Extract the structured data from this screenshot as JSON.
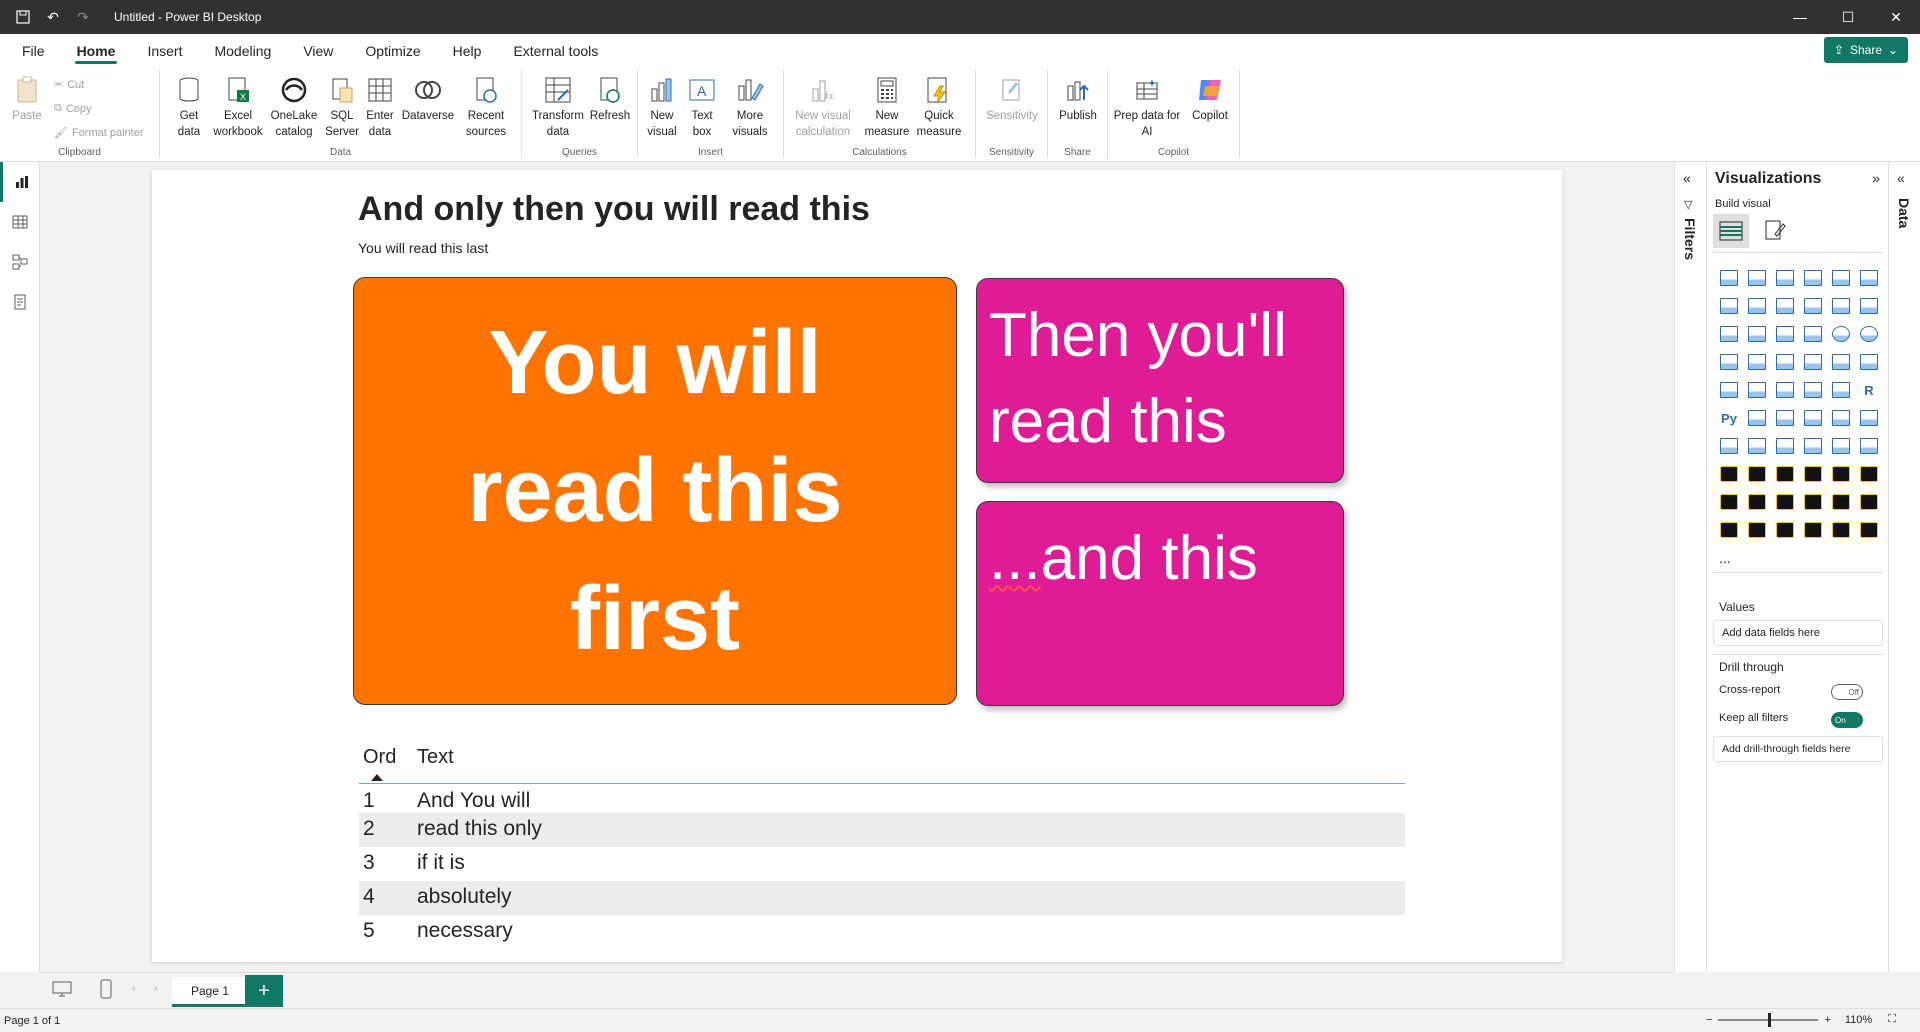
{
  "window": {
    "title": "Untitled - Power BI Desktop"
  },
  "menu": {
    "tabs": [
      "File",
      "Home",
      "Insert",
      "Modeling",
      "View",
      "Optimize",
      "Help",
      "External tools"
    ],
    "share": "Share"
  },
  "ribbon": {
    "clipboard": {
      "paste": "Paste",
      "cut": "Cut",
      "copy": "Copy",
      "format_painter": "Format painter",
      "label": "Clipboard"
    },
    "data": {
      "label": "Data",
      "get_data": [
        "Get",
        "data"
      ],
      "excel": [
        "Excel",
        "workbook"
      ],
      "onelake": [
        "OneLake",
        "catalog"
      ],
      "sql": [
        "SQL",
        "Server"
      ],
      "enter": [
        "Enter",
        "data"
      ],
      "dataverse": [
        "Dataverse",
        ""
      ],
      "recent": [
        "Recent",
        "sources"
      ]
    },
    "queries": {
      "label": "Queries",
      "transform": [
        "Transform",
        "data"
      ],
      "refresh": [
        "Refresh",
        ""
      ]
    },
    "insert": {
      "label": "Insert",
      "new_visual": [
        "New",
        "visual"
      ],
      "text_box": [
        "Text",
        "box"
      ],
      "more_visuals": [
        "More",
        "visuals"
      ]
    },
    "calculations": {
      "label": "Calculations",
      "new_visual_calc": [
        "New visual",
        "calculation"
      ],
      "new_measure": [
        "New",
        "measure"
      ],
      "quick_measure": [
        "Quick",
        "measure"
      ]
    },
    "sensitivity": {
      "label": "Sensitivity",
      "btn": [
        "Sensitivity",
        ""
      ]
    },
    "share": {
      "label": "Share",
      "publish": [
        "Publish",
        ""
      ]
    },
    "copilot": {
      "label": "Copilot",
      "prep": [
        "Prep data for",
        "AI"
      ],
      "copilot": [
        "Copilot",
        ""
      ]
    }
  },
  "report": {
    "title": "And only then you will read this",
    "subtitle": "You will read this last",
    "card_orange": [
      "You will",
      "read this",
      "first"
    ],
    "card_pink1": [
      "Then you'll",
      "read this"
    ],
    "card_pink2_prefix": "...",
    "card_pink2_text": "and this",
    "table": {
      "headers": [
        "Ord",
        "Text"
      ],
      "rows": [
        [
          "1",
          "And You will"
        ],
        [
          "2",
          "read this only"
        ],
        [
          "3",
          "if it is"
        ],
        [
          "4",
          "absolutely"
        ],
        [
          "5",
          "necessary"
        ]
      ]
    }
  },
  "panes": {
    "filters": "Filters",
    "data": "Data",
    "viz": {
      "title": "Visualizations",
      "build_visual": "Build visual",
      "values": "Values",
      "add_data_fields": "Add data fields here",
      "drill_through": "Drill through",
      "cross_report": "Cross-report",
      "cross_report_state": "Off",
      "keep_all_filters": "Keep all filters",
      "keep_all_state": "On",
      "add_drill": "Add drill-through fields here",
      "more": "..."
    }
  },
  "pages": {
    "tab": "Page 1",
    "add": "+"
  },
  "status": {
    "page": "Page 1 of 1",
    "zoom": "110%"
  }
}
